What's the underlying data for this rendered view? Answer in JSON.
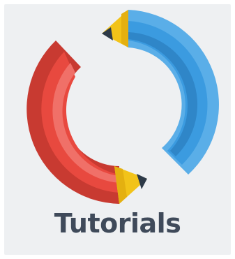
{
  "tile": {
    "label": "Tutorials",
    "icon": "tutorials-pencils-icon",
    "colors": {
      "background": "#eef0f2",
      "label": "#3f4a5a",
      "red_pencil": "#e8493f",
      "blue_pencil": "#3b9be0",
      "pencil_tip": "#f2c319",
      "lead": "#2d3a48"
    }
  }
}
